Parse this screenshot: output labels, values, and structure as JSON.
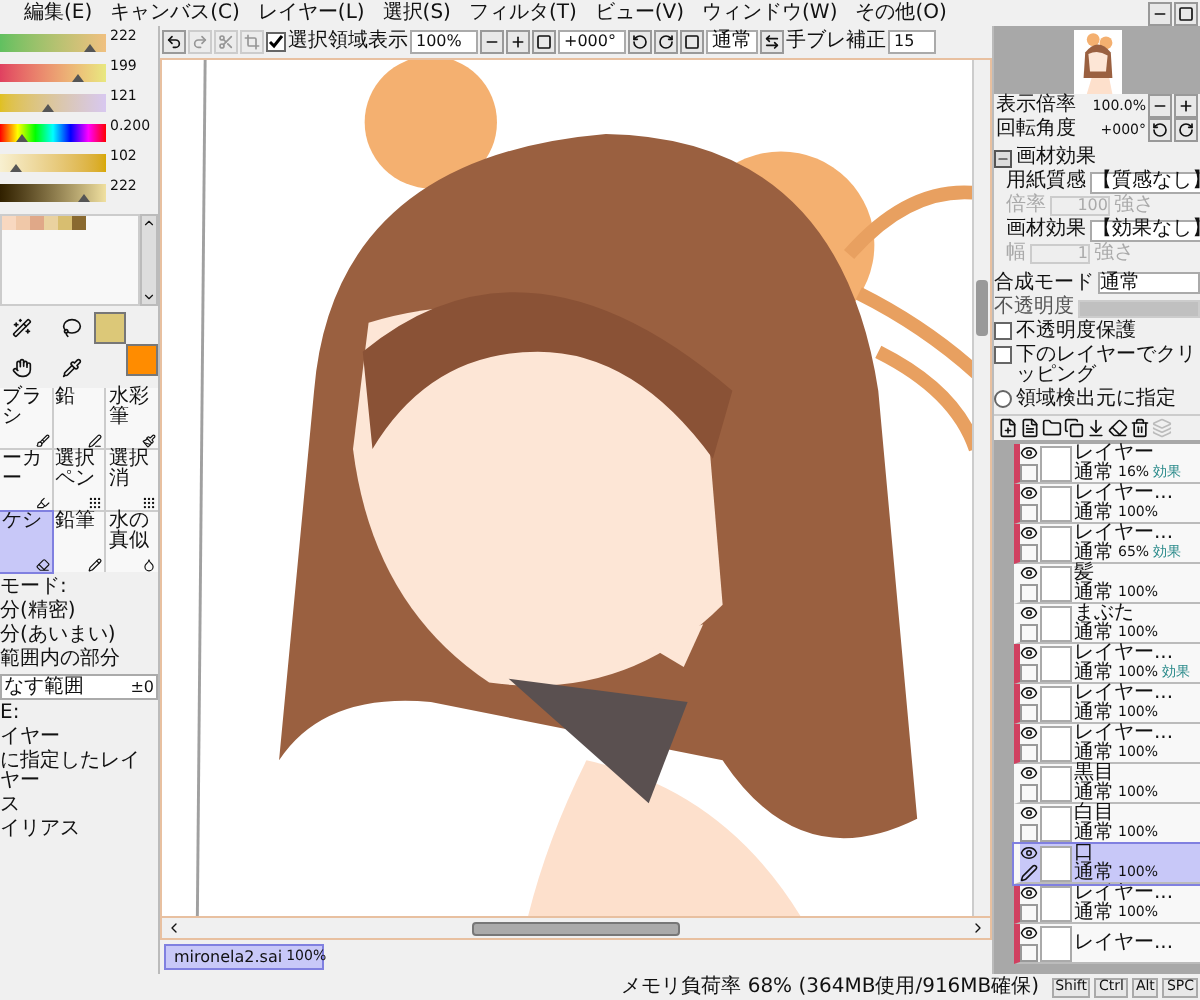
{
  "menu": [
    "編集(E)",
    "キャンバス(C)",
    "レイヤー(L)",
    "選択(S)",
    "フィルタ(T)",
    "ビュー(V)",
    "ウィンドウ(W)",
    "その他(O)"
  ],
  "toolbar": {
    "selection_toggle": {
      "label": "選択領域表示",
      "checked": true
    },
    "zoom": "100%",
    "rotation": "+000°",
    "blend": "通常",
    "stabilizer_label": "手ブレ補正",
    "stabilizer": "15"
  },
  "color_sliders": [
    {
      "value": "222",
      "level": 0.84
    },
    {
      "value": "199",
      "level": 0.74
    },
    {
      "value": "121",
      "level": 0.46
    },
    {
      "value": "0.200",
      "level": 0.2
    },
    {
      "value": "102",
      "level": 0.16
    },
    {
      "value": "222",
      "level": 0.8
    }
  ],
  "swatches": [
    {
      "color": "#f8d8c0"
    },
    {
      "color": "#f0c8a8"
    },
    {
      "color": "#e0a888"
    },
    {
      "color": "#ead2a0"
    },
    {
      "color": "#d8be70"
    },
    {
      "color": "#8a6a30"
    }
  ],
  "colors": [
    {
      "kind": "primary",
      "color": "#dcc878"
    },
    {
      "kind": "secondary",
      "color": "#ff8c00"
    }
  ],
  "tools": [
    {
      "label": "ブラシ",
      "selected": false
    },
    {
      "label": "鉛",
      "selected": false
    },
    {
      "label": "水彩筆",
      "selected": false
    },
    {
      "label": "ーカー",
      "selected": false
    },
    {
      "label": "選択ペン",
      "selected": false
    },
    {
      "label": "選択消",
      "selected": false
    },
    {
      "label": "ケシ",
      "selected": true
    },
    {
      "label": "鉛筆",
      "selected": false
    },
    {
      "label": "水の真似",
      "selected": false
    }
  ],
  "tool_options": {
    "lines": [
      "モード:",
      "分(精密)",
      "分(あいまい)",
      "範囲内の部分"
    ],
    "range_field": {
      "value": "なす範囲",
      "number": "±0"
    },
    "target_lines": [
      "E:",
      "イヤー",
      "に指定したレイヤー",
      "ス",
      "イリアス"
    ]
  },
  "document_tab": {
    "name": "mironela2.sai",
    "zoom": "100%",
    "selected": true
  },
  "navigator": {
    "zoom_label": "表示倍率",
    "zoom": "100.0%",
    "angle_label": "回転角度",
    "angle": "+000°"
  },
  "texture": {
    "title": "画材効果",
    "expanded": true,
    "rows": [
      {
        "kind": "select",
        "label": "用紙質感",
        "value": "【質感なし】"
      },
      {
        "kind": "params",
        "disabled": true,
        "label": "倍率",
        "value": "100",
        "label2": "強さ"
      },
      {
        "kind": "select",
        "label": "画材効果",
        "value": "【効果なし】"
      },
      {
        "kind": "params",
        "disabled": true,
        "label": "幅",
        "value": "1",
        "label2": "強さ"
      }
    ]
  },
  "blend": {
    "label": "合成モード",
    "value": "通常"
  },
  "opacity": {
    "label": "不透明度",
    "level": 1
  },
  "layer_options": [
    {
      "kind": "checkbox",
      "label": "不透明度保護",
      "checked": false
    },
    {
      "kind": "checkbox",
      "label": "下のレイヤーでクリッピング",
      "checked": false
    },
    {
      "kind": "radio",
      "label": "領域検出元に指定",
      "checked": false
    }
  ],
  "layers": [
    {
      "name": "レイヤー",
      "mode": "通常",
      "opacity": "16%",
      "effect": "効果",
      "clipping": true,
      "selected": false
    },
    {
      "name": "レイヤー...",
      "mode": "通常",
      "opacity": "100%",
      "clipping": true,
      "selected": false
    },
    {
      "name": "レイヤー...",
      "mode": "通常",
      "opacity": "65%",
      "effect": "効果",
      "clipping": true,
      "selected": false
    },
    {
      "name": "髪",
      "mode": "通常",
      "opacity": "100%",
      "clipping": false,
      "selected": false
    },
    {
      "name": "まぶた",
      "mode": "通常",
      "opacity": "100%",
      "clipping": false,
      "selected": false
    },
    {
      "name": "レイヤー...",
      "mode": "通常",
      "opacity": "100%",
      "effect": "効果",
      "clipping": true,
      "selected": false
    },
    {
      "name": "レイヤー...",
      "mode": "通常",
      "opacity": "100%",
      "clipping": true,
      "selected": false
    },
    {
      "name": "レイヤー...",
      "mode": "通常",
      "opacity": "100%",
      "clipping": true,
      "selected": false
    },
    {
      "name": "黒目",
      "mode": "通常",
      "opacity": "100%",
      "clipping": false,
      "selected": false
    },
    {
      "name": "白目",
      "mode": "通常",
      "opacity": "100%",
      "clipping": false,
      "selected": false
    },
    {
      "name": "口",
      "mode": "通常",
      "opacity": "100%",
      "clipping": false,
      "selected": true
    },
    {
      "name": "レイヤー...",
      "mode": "通常",
      "opacity": "100%",
      "clipping": true,
      "selected": false
    },
    {
      "name": "レイヤー...",
      "clipping": true,
      "selected": false
    }
  ],
  "status": {
    "memory": "メモリ負荷率 68% (364MB使用/916MB確保)",
    "keys": [
      "Shift",
      "Ctrl",
      "Alt",
      "SPC"
    ]
  }
}
